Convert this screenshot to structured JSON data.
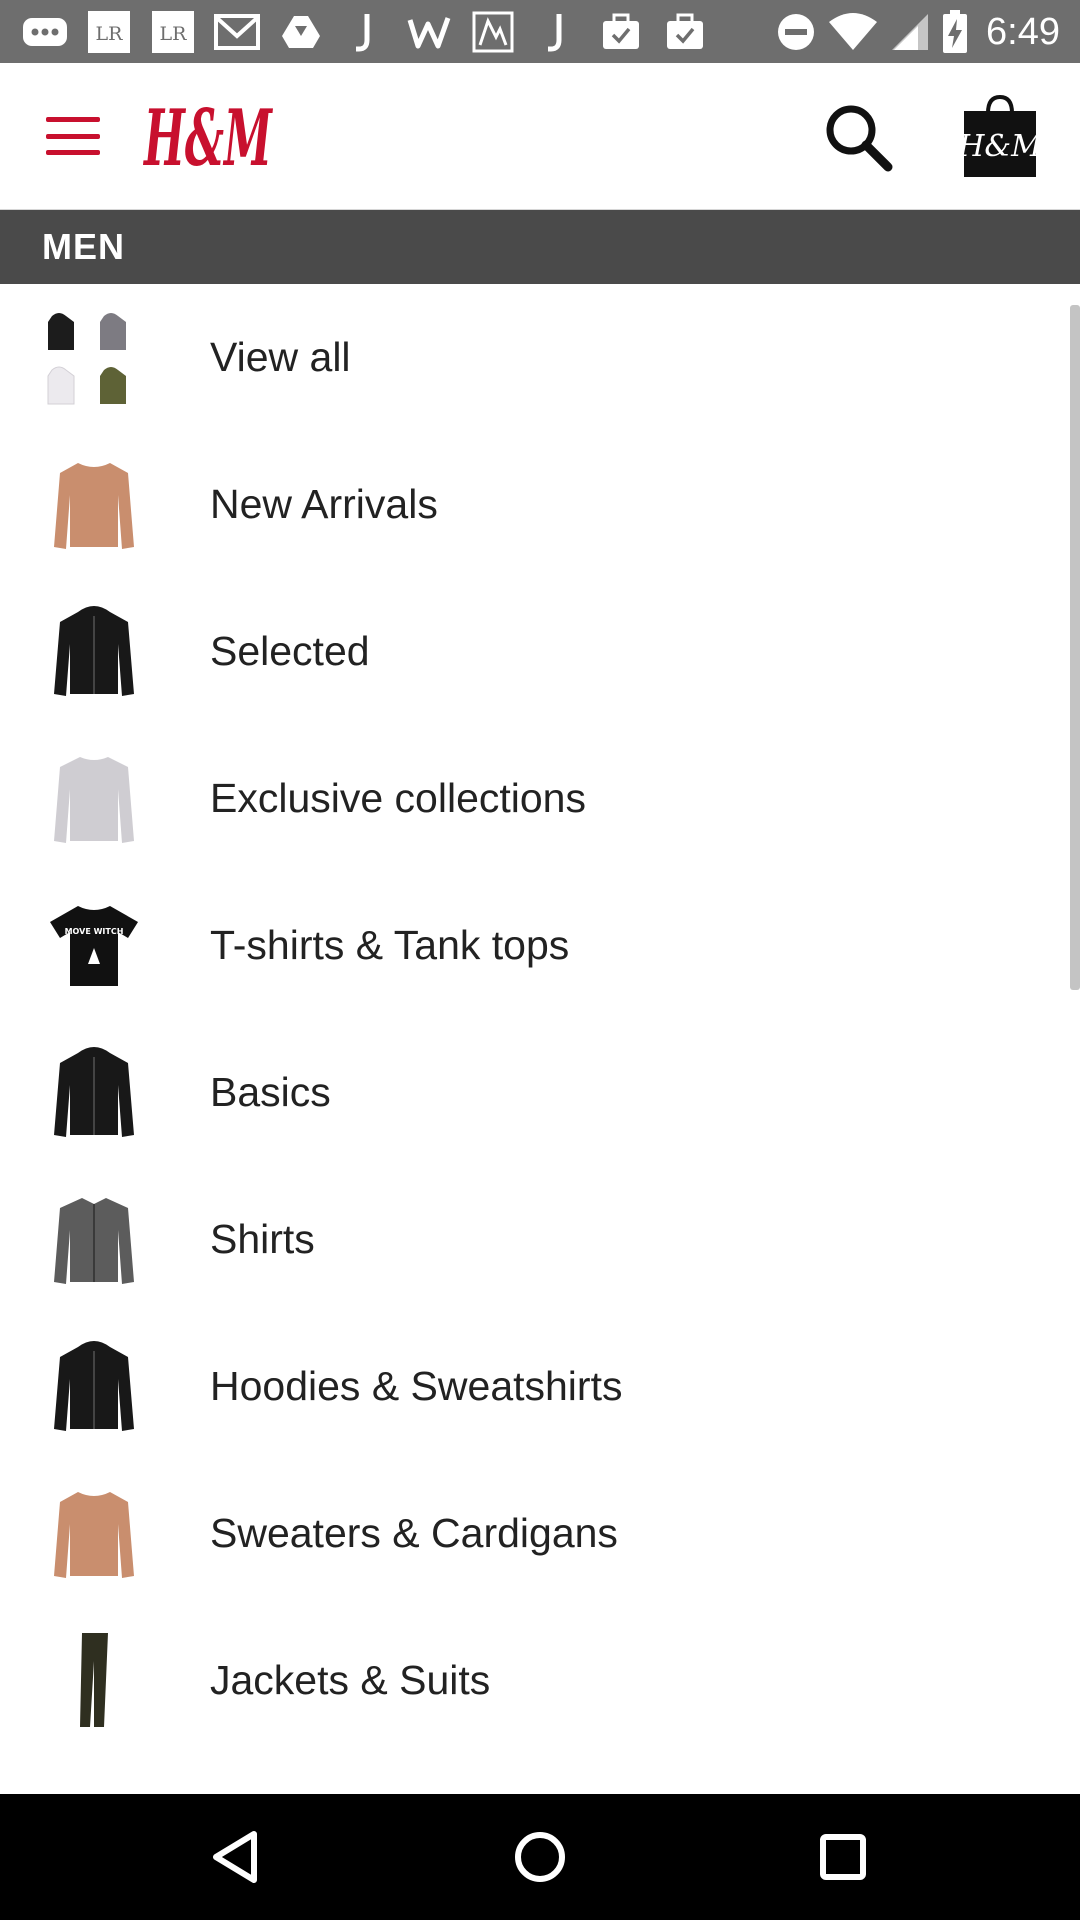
{
  "status_bar": {
    "time": "6:49",
    "left_icons": [
      "more-icon",
      "lr-icon",
      "lr-icon",
      "gmail-icon",
      "drive-icon",
      "j-icon",
      "w-icon",
      "map-icon",
      "j-icon",
      "briefcase-check-icon",
      "briefcase-check-icon"
    ],
    "right_icons": [
      "do-not-disturb-icon",
      "wifi-icon",
      "signal-icon",
      "battery-charging-icon"
    ],
    "lr_text": "LR"
  },
  "header": {
    "logo_text": "H&M",
    "bag_text": "H&M",
    "brand_color": "#c8102e"
  },
  "section": {
    "title": "MEN"
  },
  "categories": [
    {
      "label": "View all",
      "thumb": "hoodies-grid"
    },
    {
      "label": "New Arrivals",
      "thumb": "sweater-tan"
    },
    {
      "label": "Selected",
      "thumb": "jacket-black"
    },
    {
      "label": "Exclusive collections",
      "thumb": "sweater-grey"
    },
    {
      "label": "T-shirts & Tank tops",
      "thumb": "tshirt-black"
    },
    {
      "label": "Basics",
      "thumb": "jacket-black"
    },
    {
      "label": "Shirts",
      "thumb": "shirt-grey"
    },
    {
      "label": "Hoodies & Sweatshirts",
      "thumb": "jacket-black"
    },
    {
      "label": "Sweaters & Cardigans",
      "thumb": "sweater-tan"
    },
    {
      "label": "Jackets & Suits",
      "thumb": "trousers-olive"
    }
  ],
  "tshirt_print": "MOVE WITCH",
  "nav_bar": {
    "buttons": [
      "back-icon",
      "home-icon",
      "recents-icon"
    ]
  }
}
